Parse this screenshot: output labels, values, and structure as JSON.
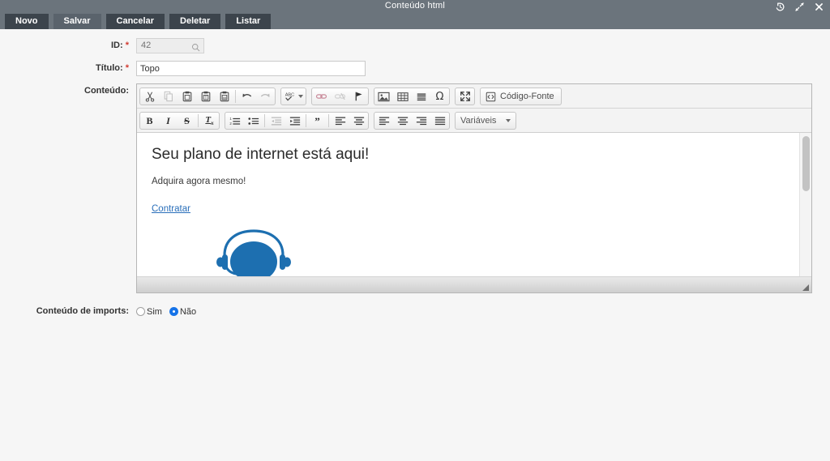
{
  "window": {
    "title": "Conteúdo html",
    "controls": [
      {
        "name": "history-restore-icon",
        "label": "Restaurar"
      },
      {
        "name": "expand-icon",
        "label": "Expandir"
      },
      {
        "name": "close-icon",
        "label": "Fechar"
      }
    ]
  },
  "tabbar": {
    "buttons": [
      {
        "label": "Novo",
        "name": "novo-button",
        "active": false
      },
      {
        "label": "Salvar",
        "name": "salvar-button",
        "active": true
      },
      {
        "label": "Cancelar",
        "name": "cancelar-button",
        "active": false
      },
      {
        "label": "Deletar",
        "name": "deletar-button",
        "active": false
      },
      {
        "label": "Listar",
        "name": "listar-button",
        "active": false
      }
    ],
    "underline_color": "#ee3124"
  },
  "form": {
    "id": {
      "label": "ID:",
      "required": "*",
      "value": "42",
      "placeholder": ""
    },
    "titulo": {
      "label": "Título:",
      "required": "*",
      "value": "Topo",
      "placeholder": ""
    },
    "conteudo": {
      "label": "Conteúdo:"
    },
    "imports": {
      "label": "Conteúdo de imports:",
      "options": [
        {
          "label": "Sim",
          "checked": false
        },
        {
          "label": "Não",
          "checked": true
        }
      ]
    }
  },
  "editor": {
    "toolbar_row1": [
      {
        "name": "cut-icon",
        "title": "Cortar",
        "disabled": false
      },
      {
        "name": "copy-icon",
        "title": "Copiar",
        "disabled": true
      },
      {
        "name": "paste-icon",
        "title": "Colar",
        "disabled": false
      },
      {
        "name": "paste-text-icon",
        "title": "Colar como texto sem formatação",
        "disabled": false
      },
      {
        "name": "paste-word-icon",
        "title": "Colar do Word",
        "disabled": false
      },
      {
        "name": "undo-icon",
        "title": "Desfazer",
        "disabled": false
      },
      {
        "name": "redo-icon",
        "title": "Refazer",
        "disabled": true
      },
      {
        "name": "spellcheck-icon",
        "title": "Verificar ortografia",
        "disabled": false
      },
      {
        "name": "link-icon",
        "title": "Link",
        "disabled": false
      },
      {
        "name": "unlink-icon",
        "title": "Remover link",
        "disabled": true
      },
      {
        "name": "anchor-icon",
        "title": "Âncora",
        "disabled": false
      },
      {
        "name": "image-icon",
        "title": "Imagem",
        "disabled": false
      },
      {
        "name": "table-icon",
        "title": "Tabela",
        "disabled": false
      },
      {
        "name": "horizontal-rule-icon",
        "title": "Linha horizontal",
        "disabled": false
      },
      {
        "name": "special-char-icon",
        "title": "Caractere especial",
        "disabled": false
      },
      {
        "name": "maximize-icon",
        "title": "Maximizar",
        "disabled": false
      }
    ],
    "source_button": {
      "label": "Código-Fonte",
      "name": "source-code-button"
    },
    "toolbar_row2": [
      {
        "name": "bold-icon",
        "title": "Negrito",
        "disabled": false
      },
      {
        "name": "italic-icon",
        "title": "Itálico",
        "disabled": false
      },
      {
        "name": "strikethrough-icon",
        "title": "Tachado",
        "disabled": false
      },
      {
        "name": "remove-format-icon",
        "title": "Remover formatação",
        "disabled": false
      },
      {
        "name": "numbered-list-icon",
        "title": "Lista numerada",
        "disabled": false
      },
      {
        "name": "bulleted-list-icon",
        "title": "Lista com marcadores",
        "disabled": false
      },
      {
        "name": "outdent-icon",
        "title": "Diminuir recuo",
        "disabled": true
      },
      {
        "name": "indent-icon",
        "title": "Aumentar recuo",
        "disabled": false
      },
      {
        "name": "blockquote-icon",
        "title": "Citação",
        "disabled": false
      },
      {
        "name": "align-left-icon",
        "title": "Alinhar à esquerda",
        "disabled": false
      },
      {
        "name": "align-center-icon",
        "title": "Centralizar",
        "disabled": false
      },
      {
        "name": "align-right-icon",
        "title": "Alinhar à direita",
        "disabled": false
      },
      {
        "name": "align-justify-icon",
        "title": "Justificar",
        "disabled": false
      }
    ],
    "variables_dropdown": {
      "label": "Variáveis",
      "name": "variaveis-dropdown"
    },
    "content": {
      "heading": "Seu plano de internet está aqui!",
      "paragraph": "Adquira agora mesmo!",
      "link": "Contratar",
      "image_name": "headset-image",
      "image_color": "#1d6fb0"
    }
  },
  "colors": {
    "header_bg": "#6b747c",
    "tab_bg": "#3c444c",
    "tab_active_bg": "#5a636c",
    "accent_red": "#ee3124",
    "link_blue": "#2a6fba",
    "radio_blue": "#1673e8",
    "page_bg": "#f6f6f6"
  }
}
